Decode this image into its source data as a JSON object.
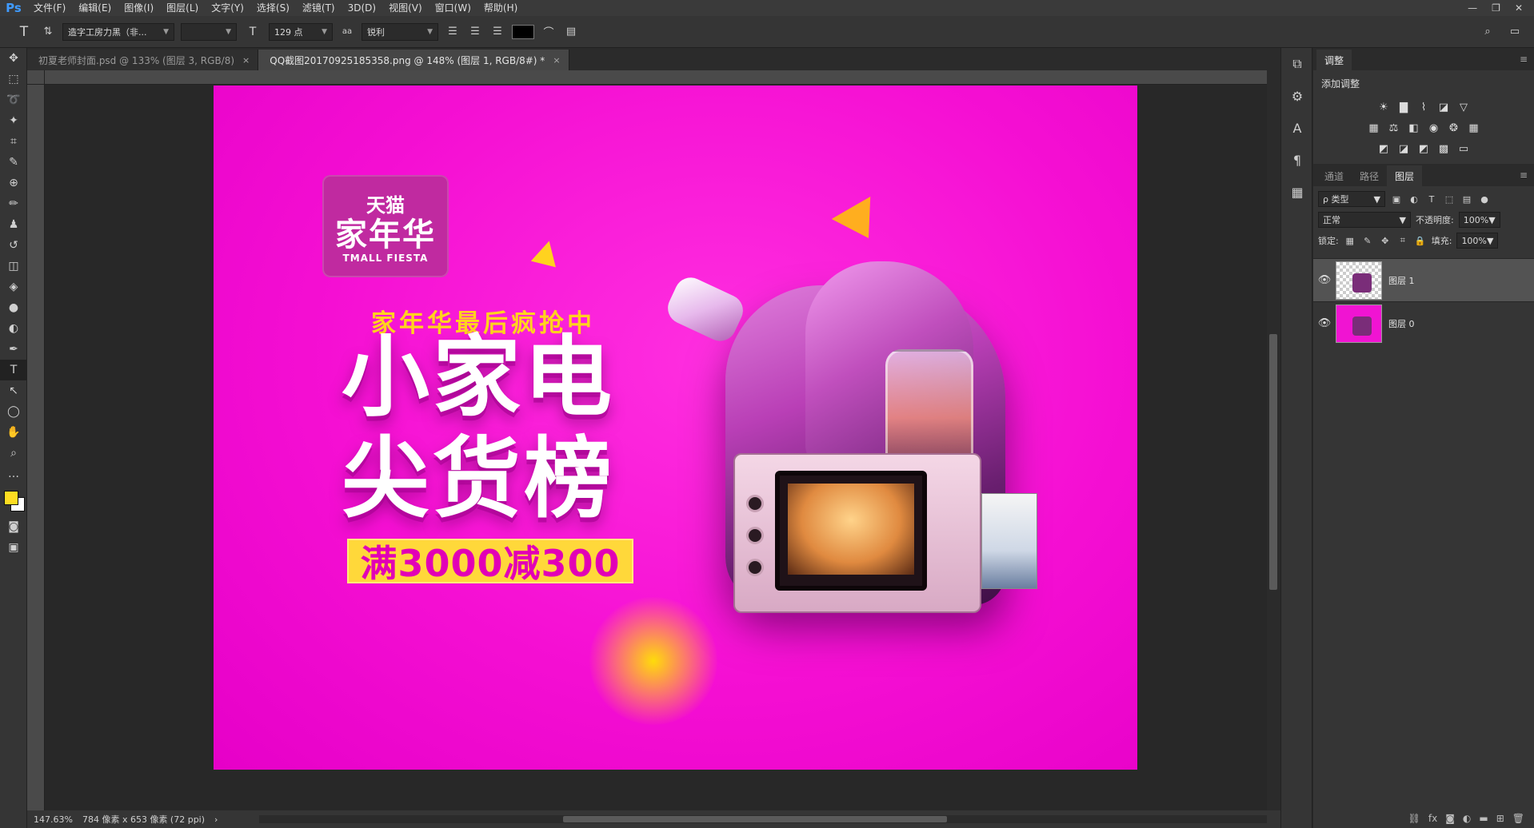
{
  "app": {
    "logo": "Ps"
  },
  "menu": [
    "文件(F)",
    "编辑(E)",
    "图像(I)",
    "图层(L)",
    "文字(Y)",
    "选择(S)",
    "滤镜(T)",
    "3D(D)",
    "视图(V)",
    "窗口(W)",
    "帮助(H)"
  ],
  "options": {
    "font_family": "造字工房力黑（非...",
    "font_size": "129 点",
    "antialias_icon_label": "aa",
    "antialias": "锐利",
    "text_color": "#000000"
  },
  "tabs": [
    {
      "label": "初夏老师封面.psd @ 133% (图层 3, RGB/8)",
      "close": "×"
    },
    {
      "label": "QQ截图20170925185358.png @ 148% (图层 1, RGB/8#) *",
      "close": "×"
    }
  ],
  "status": {
    "zoom": "147.63%",
    "doc_info": "784 像素 x 653 像素 (72 ppi)"
  },
  "panels": {
    "adjustments": {
      "tab": "调整",
      "subtitle": "添加调整"
    },
    "layers_panel": {
      "tabs": [
        "通道",
        "路径",
        "图层"
      ],
      "filter": "ρ 类型",
      "blend_mode": "正常",
      "opacity_label": "不透明度:",
      "opacity": "100%",
      "lock_label": "锁定:",
      "fill_label": "填充:",
      "fill": "100%",
      "layers": [
        {
          "name": "图层 1",
          "visible": true,
          "selected": true
        },
        {
          "name": "图层 0",
          "visible": true,
          "selected": false
        }
      ],
      "footer_icons": [
        "link-icon",
        "fx-icon",
        "mask-icon",
        "adjustment-icon",
        "folder-icon",
        "new-layer-icon",
        "trash-icon"
      ]
    }
  },
  "artwork": {
    "badge_top": "天猫",
    "badge_main": "家年华",
    "badge_sub": "TMALL FIESTA",
    "promo_line": "家年华最后疯抢中",
    "headline_1": "小家电",
    "headline_2": "尖货榜",
    "deal": "满3000减300"
  },
  "colors": {
    "canvas_magenta": "#f014d2",
    "foreground": "#ffdd22",
    "background": "#ffffff",
    "promo_yellow": "#ffd21f"
  }
}
